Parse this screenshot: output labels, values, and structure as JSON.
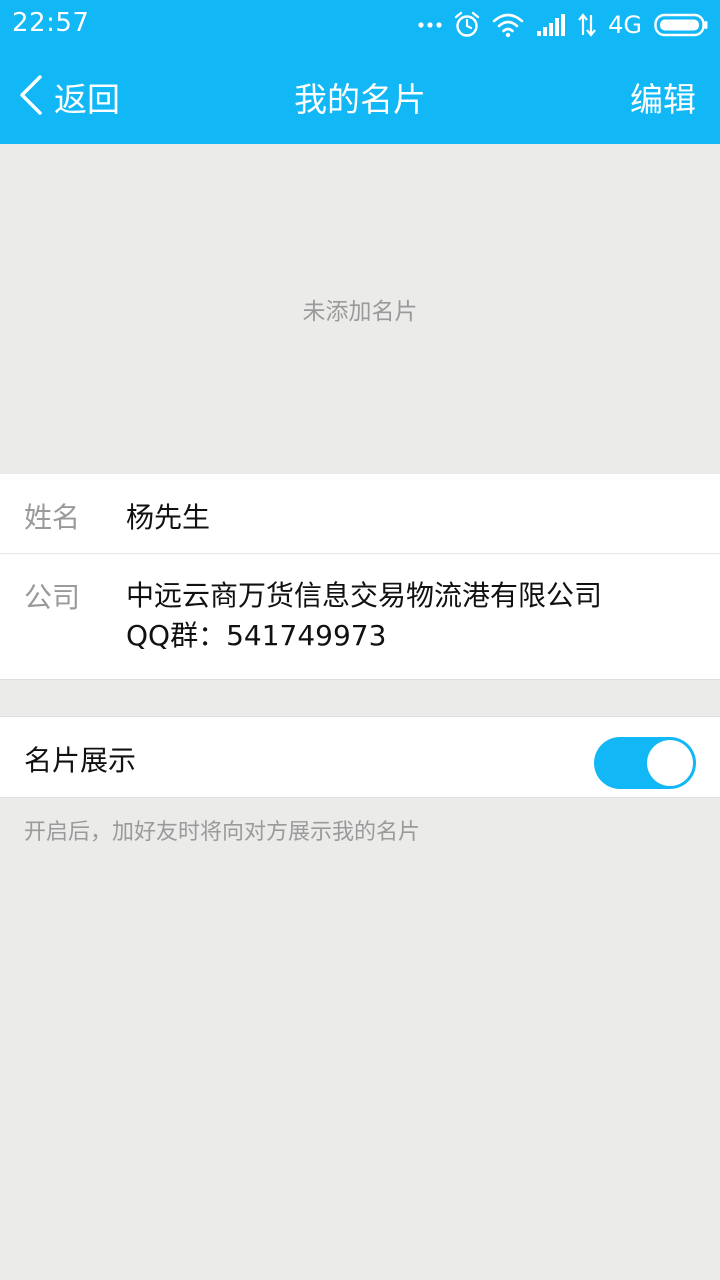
{
  "status_bar": {
    "time": "22:57",
    "network": "4G",
    "icons": [
      "more-dots-icon",
      "alarm-icon",
      "wifi-icon",
      "signal-icon",
      "data-transfer-icon",
      "battery-icon"
    ]
  },
  "header": {
    "back_label": "返回",
    "title": "我的名片",
    "edit_label": "编辑"
  },
  "card": {
    "empty_text": "未添加名片"
  },
  "profile": {
    "name_label": "姓名",
    "name_value": "杨先生",
    "company_label": "公司",
    "company_line1": "中远云商万货信息交易物流港有限公司",
    "company_line2": "QQ群：541749973"
  },
  "card_display": {
    "label": "名片展示",
    "enabled": true,
    "hint": "开启后，加好友时将向对方展示我的名片"
  },
  "colors": {
    "primary": "#12b7f5",
    "background": "#ebecea",
    "muted_text": "#9a9a9a",
    "text": "#111111"
  }
}
